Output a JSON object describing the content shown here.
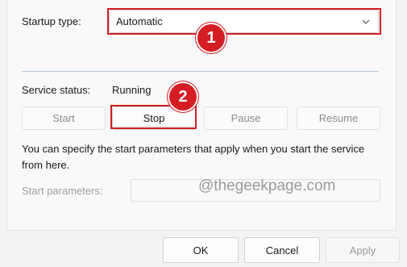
{
  "startup": {
    "label": "Startup type:",
    "selected": "Automatic"
  },
  "service": {
    "status_label": "Service status:",
    "status_value": "Running"
  },
  "controls": {
    "start": "Start",
    "stop": "Stop",
    "pause": "Pause",
    "resume": "Resume"
  },
  "description": "You can specify the start parameters that apply when you start the service from here.",
  "params": {
    "label": "Start parameters:",
    "value": ""
  },
  "watermark": "@thegeekpage.com",
  "annotations": {
    "step1": "1",
    "step2": "2",
    "color": "#d51d24"
  },
  "footer": {
    "ok": "OK",
    "cancel": "Cancel",
    "apply": "Apply"
  }
}
